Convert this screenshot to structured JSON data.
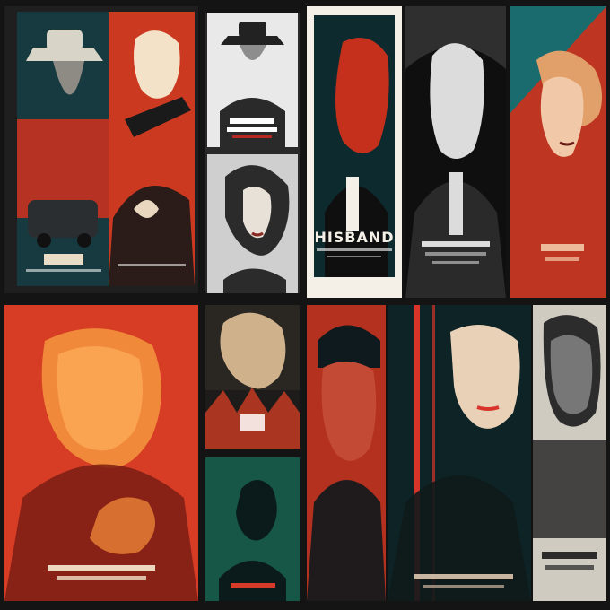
{
  "collage": {
    "description_colors": {
      "red": "#d8321f",
      "teal": "#1f8a86",
      "cream": "#e8dcc6",
      "charcoal": "#1d1d1d"
    },
    "posters": [
      {
        "id": "p1",
        "title": "",
        "palette": [
          "#132b34",
          "#c8321f",
          "#e9d8bf"
        ],
        "subject": "man-with-hat-and-car"
      },
      {
        "id": "p2",
        "title": "",
        "palette": [
          "#1b1b1b",
          "#d63b22",
          "#f3e2c8"
        ],
        "subject": "man-with-gun"
      },
      {
        "id": "p3",
        "title": "",
        "palette": [
          "#e9e9e9",
          "#2a2a2a",
          "#b72a21"
        ],
        "subject": "man-in-fedora"
      },
      {
        "id": "p4",
        "title": "",
        "palette": [
          "#cfcfcf",
          "#2b2b2b",
          "#8a2a23"
        ],
        "subject": "woman-portrait"
      },
      {
        "id": "p5",
        "title": "HISBAND",
        "palette": [
          "#f4f0e7",
          "#0d2b2f",
          "#c5301d"
        ],
        "subject": "man-suit-red"
      },
      {
        "id": "p6",
        "title": "",
        "palette": [
          "#0f0f0f",
          "#dcdcdc",
          "#6f6f6f"
        ],
        "subject": "man-suit-bw"
      },
      {
        "id": "p7",
        "title": "",
        "palette": [
          "#1a6b6e",
          "#c7331e",
          "#f2c9a8"
        ],
        "subject": "woman-profile"
      },
      {
        "id": "p8",
        "title": "",
        "palette": [
          "#1f5c56",
          "#e23a22",
          "#f08a3a"
        ],
        "subject": "man-red-face"
      },
      {
        "id": "p9",
        "title": "",
        "palette": [
          "#2a2622",
          "#cfb28c",
          "#c33a21"
        ],
        "subject": "woman-sepia"
      },
      {
        "id": "p10",
        "title": "",
        "palette": [
          "#0e2f2c",
          "#2fcf9a",
          "#d63b2a"
        ],
        "subject": "silhouette-teal"
      },
      {
        "id": "p11",
        "title": "",
        "palette": [
          "#2a1a15",
          "#e23a22",
          "#0e1a1d"
        ],
        "subject": "soldier-red"
      },
      {
        "id": "p12",
        "title": "",
        "palette": [
          "#0d2326",
          "#d9342a",
          "#e9d1b8"
        ],
        "subject": "woman-teal-red"
      },
      {
        "id": "p13",
        "title": "",
        "palette": [
          "#cfcbc1",
          "#2c2c2c",
          "#777"
        ],
        "subject": "man-gray-mech"
      }
    ]
  }
}
